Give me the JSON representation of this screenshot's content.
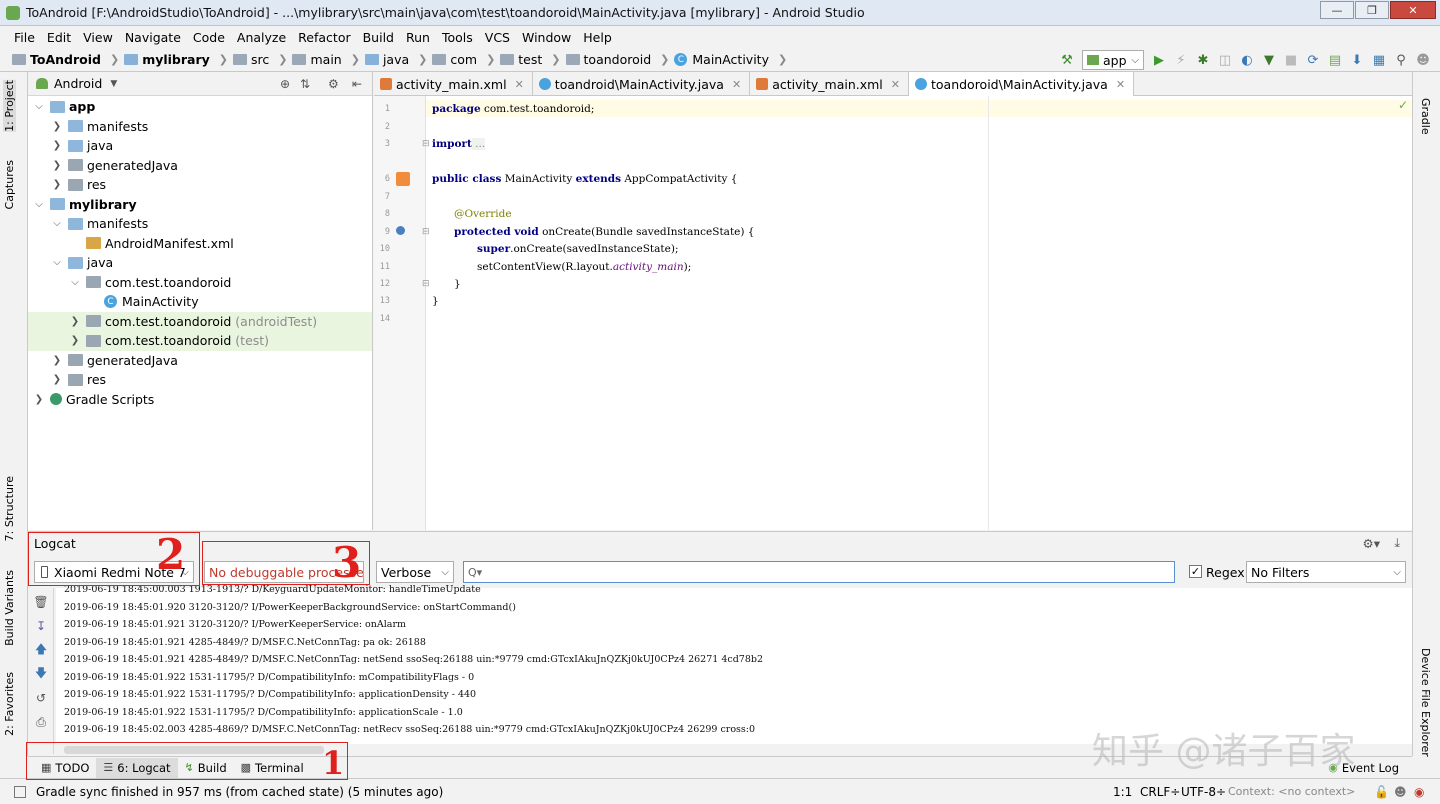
{
  "window": {
    "title": "ToAndroid [F:\\AndroidStudio\\ToAndroid] - ...\\mylibrary\\src\\main\\java\\com\\test\\toandoroid\\MainActivity.java [mylibrary] - Android Studio"
  },
  "menu": [
    "File",
    "Edit",
    "View",
    "Navigate",
    "Code",
    "Analyze",
    "Refactor",
    "Build",
    "Run",
    "Tools",
    "VCS",
    "Window",
    "Help"
  ],
  "breadcrumb": [
    "ToAndroid",
    "mylibrary",
    "src",
    "main",
    "java",
    "com",
    "test",
    "toandoroid",
    "MainActivity"
  ],
  "toolbar": {
    "run_config": "app"
  },
  "left_tabs": {
    "project": "1: Project",
    "captures": "Captures",
    "structure": "7: Structure",
    "build_variants": "Build Variants",
    "favorites": "2: Favorites"
  },
  "right_tabs": {
    "gradle": "Gradle",
    "device_file_explorer": "Device File Explorer"
  },
  "project": {
    "view": "Android",
    "tree": [
      {
        "label": "app",
        "note": ""
      },
      {
        "label": "manifests",
        "note": ""
      },
      {
        "label": "java",
        "note": ""
      },
      {
        "label": "generatedJava",
        "note": ""
      },
      {
        "label": "res",
        "note": ""
      },
      {
        "label": "mylibrary",
        "note": ""
      },
      {
        "label": "manifests",
        "note": ""
      },
      {
        "label": "AndroidManifest.xml",
        "note": ""
      },
      {
        "label": "java",
        "note": ""
      },
      {
        "label": "com.test.toandoroid",
        "note": ""
      },
      {
        "label": "MainActivity",
        "note": ""
      },
      {
        "label": "com.test.toandoroid",
        "note": "(androidTest)"
      },
      {
        "label": "com.test.toandoroid",
        "note": "(test)"
      },
      {
        "label": "generatedJava",
        "note": ""
      },
      {
        "label": "res",
        "note": ""
      },
      {
        "label": "Gradle Scripts",
        "note": ""
      }
    ]
  },
  "editor_tabs": [
    "activity_main.xml",
    "toandroid\\MainActivity.java",
    "activity_main.xml",
    "toandoroid\\MainActivity.java"
  ],
  "code": {
    "line_numbers": [
      "1",
      "2",
      "3",
      "6",
      "7",
      "8",
      "9",
      "10",
      "11",
      "12",
      "13",
      "14"
    ],
    "l1_kw": "package",
    "l1_rest": " com.test.toandoroid;",
    "l3_kw": "import",
    "l3_rest": " ...",
    "l6_kw1": "public class",
    "l6_mid": " MainActivity ",
    "l6_kw2": "extends",
    "l6_rest": " AppCompatActivity {",
    "l8": "@Override",
    "l9_kw1": "protected void",
    "l9_rest": " onCreate(Bundle savedInstanceState) {",
    "l10_kw": "super",
    "l10_rest": ".onCreate(savedInstanceState);",
    "l11_a": "setContentView(R.layout.",
    "l11_it": "activity_main",
    "l11_b": ");",
    "l12": "}",
    "l13": "}"
  },
  "logcat": {
    "title": "Logcat",
    "device": "Xiaomi Redmi Note 7",
    "process": "No debuggable processe",
    "level": "Verbose",
    "search_placeholder": "Q▾",
    "regex_label": "Regex",
    "filter": "No Filters",
    "lines": [
      "2019-06-19 18:45:00.003 1913-1913/? D/KeyguardUpdateMonitor: handleTimeUpdate",
      "2019-06-19 18:45:01.920 3120-3120/? I/PowerKeeperBackgroundService: onStartCommand()",
      "2019-06-19 18:45:01.921 3120-3120/? I/PowerKeeperService: onAlarm",
      "2019-06-19 18:45:01.921 4285-4849/? D/MSF.C.NetConnTag: pa ok: 26188",
      "2019-06-19 18:45:01.921 4285-4849/? D/MSF.C.NetConnTag: netSend ssoSeq:26188 uin:*9779 cmd:GTcxIAkuJnQZKj0kUJ0CPz4 26271 4cd78b2",
      "2019-06-19 18:45:01.922 1531-11795/? D/CompatibilityInfo: mCompatibilityFlags - 0",
      "2019-06-19 18:45:01.922 1531-11795/? D/CompatibilityInfo: applicationDensity - 440",
      "2019-06-19 18:45:01.922 1531-11795/? D/CompatibilityInfo: applicationScale - 1.0",
      "2019-06-19 18:45:02.003 4285-4869/? D/MSF.C.NetConnTag: netRecv ssoSeq:26188 uin:*9779 cmd:GTcxIAkuJnQZKj0kUJ0CPz4 26299 cross:0"
    ]
  },
  "bottom_tabs": {
    "todo": "TODO",
    "logcat": "6: Logcat",
    "build": "Build",
    "terminal": "Terminal",
    "event_log": "Event Log"
  },
  "status": {
    "message": "Gradle sync finished in 957 ms (from cached state) (5 minutes ago)",
    "position": "1:1",
    "line_sep": "CRLF÷",
    "encoding": "UTF-8÷",
    "context": "Context: <no context>"
  },
  "annotations": {
    "n1": "1",
    "n2": "2",
    "n3": "3"
  },
  "watermark": "知乎 @诸子百家"
}
